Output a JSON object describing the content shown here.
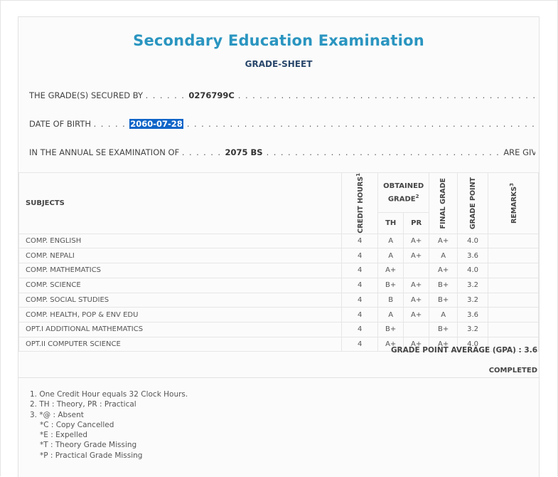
{
  "title": "Secondary Education Examination",
  "subtitle": "GRADE-SHEET",
  "secured_by": {
    "label": "THE GRADE(S) SECURED BY",
    "value": "0276799C"
  },
  "dob": {
    "label": "DATE OF BIRTH",
    "value": "2060-07-28"
  },
  "exam": {
    "label": "IN THE ANNUAL SE EXAMINATION OF",
    "value": "2075 BS",
    "suffix": "ARE GIVEN BELOW"
  },
  "table": {
    "headers": {
      "subjects": "SUBJECTS",
      "credit_hours": "CREDIT HOURS",
      "credit_sup": "1",
      "obtained_grade": "OBTAINED GRADE",
      "obtained_sup": "2",
      "th": "TH",
      "pr": "PR",
      "final_grade": "FINAL GRADE",
      "grade_point": "GRADE POINT",
      "remarks": "REMARKS",
      "remarks_sup": "3"
    },
    "rows": [
      {
        "subject": "COMP. ENGLISH",
        "credit": "4",
        "th": "A",
        "pr": "A+",
        "final": "A+",
        "point": "4.0",
        "remarks": ""
      },
      {
        "subject": "COMP. NEPALI",
        "credit": "4",
        "th": "A",
        "pr": "A+",
        "final": "A",
        "point": "3.6",
        "remarks": ""
      },
      {
        "subject": "COMP. MATHEMATICS",
        "credit": "4",
        "th": "A+",
        "pr": "",
        "final": "A+",
        "point": "4.0",
        "remarks": ""
      },
      {
        "subject": "COMP. SCIENCE",
        "credit": "4",
        "th": "B+",
        "pr": "A+",
        "final": "B+",
        "point": "3.2",
        "remarks": ""
      },
      {
        "subject": "COMP. SOCIAL STUDIES",
        "credit": "4",
        "th": "B",
        "pr": "A+",
        "final": "B+",
        "point": "3.2",
        "remarks": ""
      },
      {
        "subject": "COMP. HEALTH, POP & ENV EDU",
        "credit": "4",
        "th": "A",
        "pr": "A+",
        "final": "A",
        "point": "3.6",
        "remarks": ""
      },
      {
        "subject": "OPT.I ADDITIONAL MATHEMATICS",
        "credit": "4",
        "th": "B+",
        "pr": "",
        "final": "B+",
        "point": "3.2",
        "remarks": ""
      },
      {
        "subject": "OPT.II COMPUTER SCIENCE",
        "credit": "4",
        "th": "A+",
        "pr": "A+",
        "final": "A+",
        "point": "4.0",
        "remarks": ""
      }
    ]
  },
  "gpa_text": "GRADE POINT AVERAGE (GPA) : 3.6",
  "status": "COMPLETED",
  "notes": [
    "1. One Credit Hour equals 32 Clock Hours.",
    "2. TH : Theory, PR : Practical",
    "3. *@ : Absent",
    "*C : Copy Cancelled",
    "*E : Expelled",
    "*T : Theory Grade Missing",
    "*P : Practical Grade Missing"
  ],
  "colors": {
    "title": "#2a95c0",
    "subtitle": "#29476b",
    "selection": "#1065c8"
  }
}
